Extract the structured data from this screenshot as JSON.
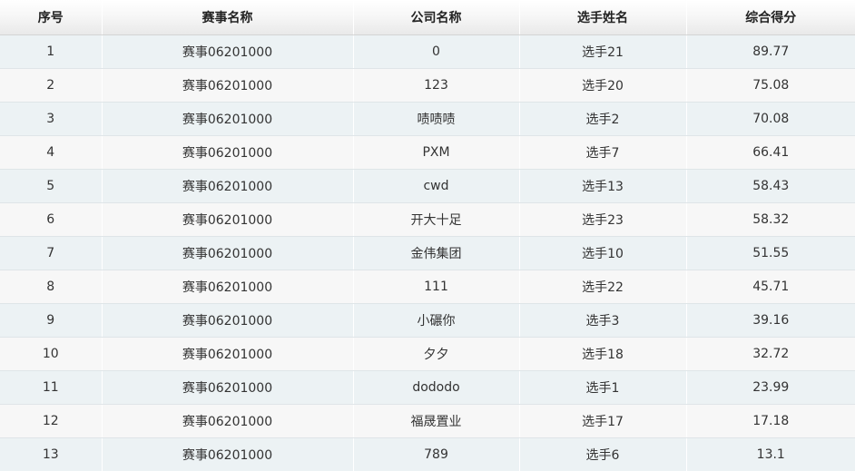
{
  "table": {
    "headers": [
      "序号",
      "赛事名称",
      "公司名称",
      "选手姓名",
      "综合得分"
    ],
    "rows": [
      [
        "1",
        "赛事06201000",
        "0",
        "选手21",
        "89.77"
      ],
      [
        "2",
        "赛事06201000",
        "123",
        "选手20",
        "75.08"
      ],
      [
        "3",
        "赛事06201000",
        "啧啧啧",
        "选手2",
        "70.08"
      ],
      [
        "4",
        "赛事06201000",
        "PXM",
        "选手7",
        "66.41"
      ],
      [
        "5",
        "赛事06201000",
        "cwd",
        "选手13",
        "58.43"
      ],
      [
        "6",
        "赛事06201000",
        "开大十足",
        "选手23",
        "58.32"
      ],
      [
        "7",
        "赛事06201000",
        "金伟集团",
        "选手10",
        "51.55"
      ],
      [
        "8",
        "赛事06201000",
        "111",
        "选手22",
        "45.71"
      ],
      [
        "9",
        "赛事06201000",
        "小碾你",
        "选手3",
        "39.16"
      ],
      [
        "10",
        "赛事06201000",
        "夕夕",
        "选手18",
        "32.72"
      ],
      [
        "11",
        "赛事06201000",
        "dododo",
        "选手1",
        "23.99"
      ],
      [
        "12",
        "赛事06201000",
        "福晟置业",
        "选手17",
        "17.18"
      ],
      [
        "13",
        "赛事06201000",
        "789",
        "选手6",
        "13.1"
      ]
    ]
  }
}
